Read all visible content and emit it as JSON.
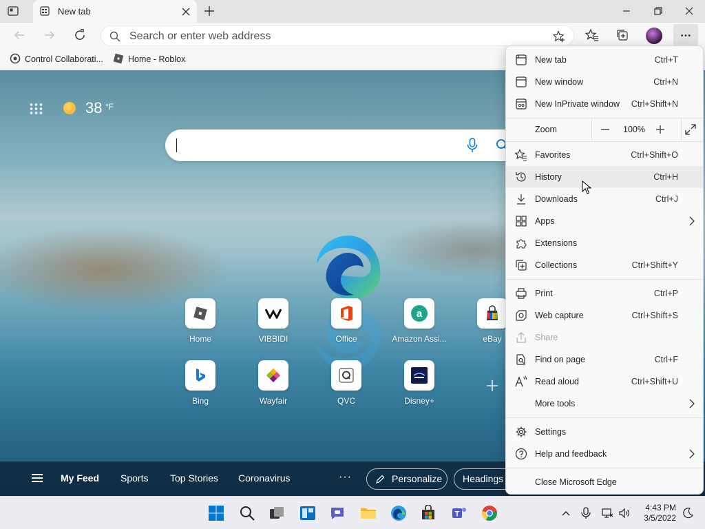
{
  "tab": {
    "title": "New tab"
  },
  "address_bar": {
    "placeholder": "Search or enter web address"
  },
  "favorites_bar": [
    {
      "label": "Control Collaborati..."
    },
    {
      "label": "Home - Roblox"
    }
  ],
  "new_tab_page": {
    "weather": {
      "temperature": "38",
      "unit": "°F"
    },
    "quick_links_row1": [
      {
        "label": "Home",
        "icon": "roblox-icon"
      },
      {
        "label": "VIBBIDI",
        "icon": "vibbidi-icon"
      },
      {
        "label": "Office",
        "icon": "office-icon"
      },
      {
        "label": "Amazon Assi...",
        "icon": "amazon-icon"
      },
      {
        "label": "eBay",
        "icon": "ebay-icon"
      }
    ],
    "quick_links_row2": [
      {
        "label": "Bing",
        "icon": "bing-icon"
      },
      {
        "label": "Wayfair",
        "icon": "wayfair-icon"
      },
      {
        "label": "QVC",
        "icon": "qvc-icon"
      },
      {
        "label": "Disney+",
        "icon": "disney-plus-icon"
      }
    ],
    "feed_tabs": [
      "My Feed",
      "Sports",
      "Top Stories",
      "Coronavirus"
    ],
    "feed_more": "···",
    "personalize_label": "Personalize",
    "headings_label": "Headings"
  },
  "menu": {
    "items": [
      {
        "label": "New tab",
        "shortcut": "Ctrl+T",
        "icon": "new-tab-icon"
      },
      {
        "label": "New window",
        "shortcut": "Ctrl+N",
        "icon": "new-window-icon"
      },
      {
        "label": "New InPrivate window",
        "shortcut": "Ctrl+Shift+N",
        "icon": "inprivate-icon"
      },
      {
        "label": "Favorites",
        "shortcut": "Ctrl+Shift+O",
        "icon": "favorites-icon"
      },
      {
        "label": "History",
        "shortcut": "Ctrl+H",
        "icon": "history-icon"
      },
      {
        "label": "Downloads",
        "shortcut": "Ctrl+J",
        "icon": "download-icon"
      },
      {
        "label": "Apps",
        "shortcut": "",
        "icon": "apps-icon"
      },
      {
        "label": "Extensions",
        "shortcut": "",
        "icon": "extensions-icon"
      },
      {
        "label": "Collections",
        "shortcut": "Ctrl+Shift+Y",
        "icon": "collections-icon"
      },
      {
        "label": "Print",
        "shortcut": "Ctrl+P",
        "icon": "print-icon"
      },
      {
        "label": "Web capture",
        "shortcut": "Ctrl+Shift+S",
        "icon": "web-capture-icon"
      },
      {
        "label": "Share",
        "shortcut": "",
        "icon": "share-icon"
      },
      {
        "label": "Find on page",
        "shortcut": "Ctrl+F",
        "icon": "find-icon"
      },
      {
        "label": "Read aloud",
        "shortcut": "Ctrl+Shift+U",
        "icon": "read-aloud-icon"
      },
      {
        "label": "More tools",
        "shortcut": "",
        "icon": ""
      },
      {
        "label": "Settings",
        "shortcut": "",
        "icon": "settings-icon"
      },
      {
        "label": "Help and feedback",
        "shortcut": "",
        "icon": "help-icon"
      },
      {
        "label": "Close Microsoft Edge",
        "shortcut": "",
        "icon": ""
      }
    ],
    "zoom": {
      "label": "Zoom",
      "value": "100%"
    }
  },
  "taskbar": {
    "time": "4:43 PM",
    "date": "3/5/2022"
  },
  "colors": {
    "accent": "#0078d4",
    "menu_bg": "#f9f9f9",
    "hover": "#ebebeb",
    "disabled_text": "#a5a5a5"
  }
}
